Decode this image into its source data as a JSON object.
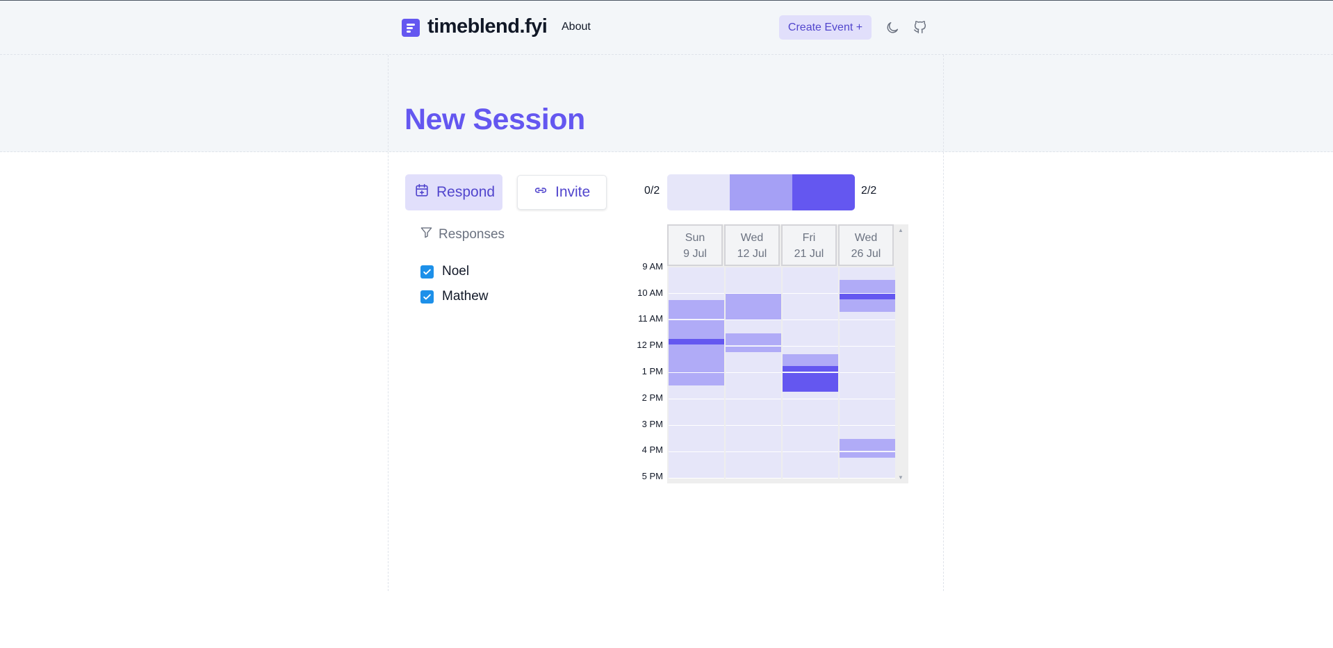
{
  "header": {
    "brand": "timeblend.fyi",
    "nav_about": "About",
    "create_event_label": "Create Event +"
  },
  "icons": {
    "logo": "logo-icon",
    "theme_toggle": "moon-icon",
    "repo": "github-icon",
    "respond": "calendar-plus-icon",
    "invite": "link-icon",
    "filter": "filter-icon",
    "checkbox": "check-icon"
  },
  "page": {
    "title": "New Session"
  },
  "actions": {
    "respond_label": "Respond",
    "invite_label": "Invite"
  },
  "responses": {
    "label": "Responses",
    "people": [
      {
        "name": "Noel",
        "checked": true
      },
      {
        "name": "Mathew",
        "checked": true
      }
    ]
  },
  "legend": {
    "min_label": "0/2",
    "max_label": "2/2",
    "colors": [
      "#e6e6f9",
      "#a5a0f5",
      "#6457f0"
    ]
  },
  "schedule": {
    "days": [
      {
        "dow": "Sun",
        "date": "9 Jul"
      },
      {
        "dow": "Wed",
        "date": "12 Jul"
      },
      {
        "dow": "Fri",
        "date": "21 Jul"
      },
      {
        "dow": "Wed",
        "date": "26 Jul"
      }
    ],
    "times": [
      "9 AM",
      "10 AM",
      "11 AM",
      "12 PM",
      "1 PM",
      "2 PM",
      "3 PM",
      "4 PM",
      "5 PM"
    ]
  },
  "colors": {
    "accent": "#6457f0",
    "accent_soft": "#e1dffb",
    "checkbox": "#1d90e9"
  }
}
